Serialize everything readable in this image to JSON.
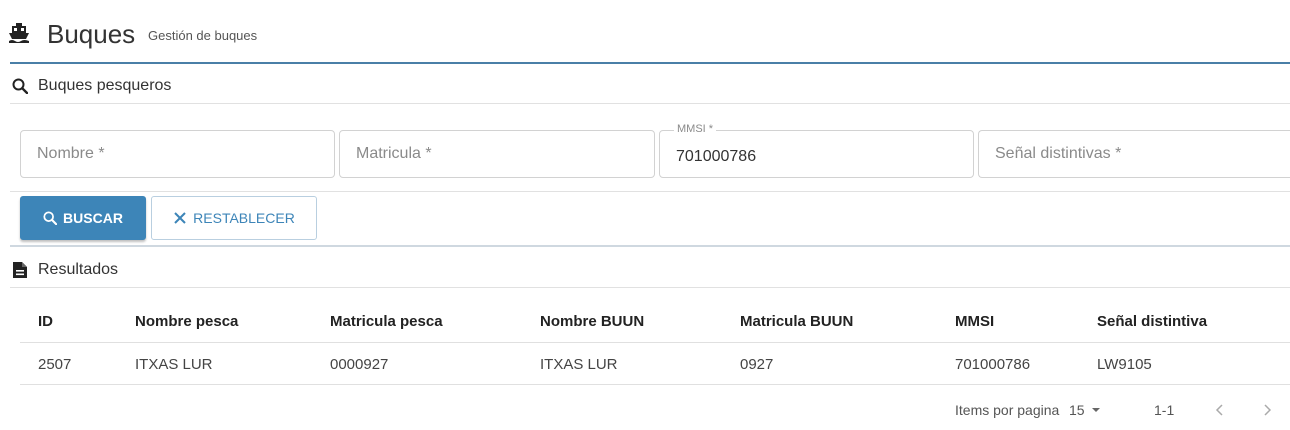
{
  "header": {
    "icon": "ship-icon",
    "title": "Buques",
    "subtitle": "Gestión de buques"
  },
  "search": {
    "title": "Buques pesqueros",
    "icon": "search-icon",
    "fields": {
      "nombre": {
        "placeholder": "Nombre *",
        "value": ""
      },
      "matricula": {
        "placeholder": "Matricula *",
        "value": ""
      },
      "mmsi": {
        "label": "MMSI *",
        "value": "701000786"
      },
      "senal": {
        "placeholder": "Señal distintivas *",
        "value": ""
      }
    },
    "buttons": {
      "search_label": "BUSCAR",
      "reset_label": "RESTABLECER"
    }
  },
  "results": {
    "title": "Resultados",
    "icon": "document-icon",
    "columns": [
      "ID",
      "Nombre pesca",
      "Matricula pesca",
      "Nombre BUUN",
      "Matricula BUUN",
      "MMSI",
      "Señal distintiva"
    ],
    "rows": [
      [
        "2507",
        "ITXAS LUR",
        "0000927",
        "ITXAS LUR",
        "0927",
        "701000786",
        "LW9105"
      ]
    ]
  },
  "pagination": {
    "items_label": "Items por pagina",
    "page_size": "15",
    "range": "1-1"
  },
  "colors": {
    "accent": "#3d85b8",
    "header_line": "#4a7fa7"
  }
}
